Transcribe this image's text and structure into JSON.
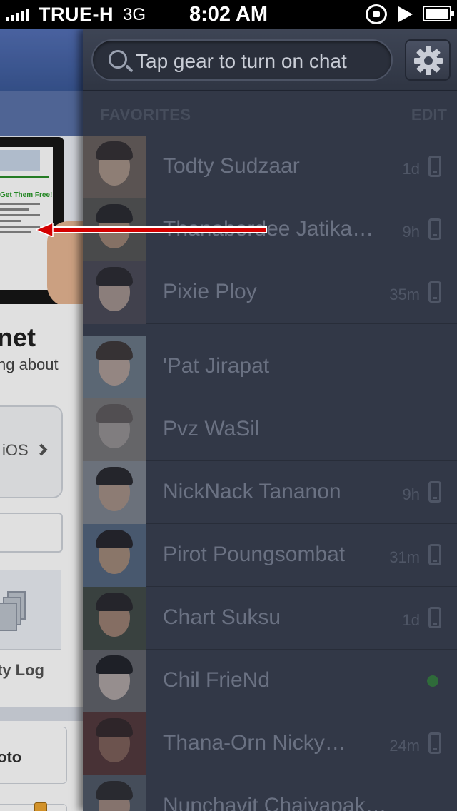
{
  "status_bar": {
    "carrier": "TRUE-H",
    "network": "3G",
    "time": "8:02 AM"
  },
  "left_page": {
    "ad_text": "Get Them Free!",
    "heading": "net",
    "subtext": "ng about",
    "ios_button_label": "iOS",
    "activity_log_label": "ty Log",
    "photo_button_label": "oto"
  },
  "chat": {
    "search": {
      "placeholder": "Tap gear to turn on chat"
    },
    "favorites": {
      "title": "FAVORITES",
      "edit_label": "EDIT"
    },
    "contacts": [
      {
        "name": "Todty Sudzaar",
        "time": "1d",
        "status": "mobile"
      },
      {
        "name": "Thanaberdee Jatika…",
        "time": "9h",
        "status": "mobile"
      },
      {
        "name": "Pixie Ploy",
        "time": "35m",
        "status": "mobile"
      },
      {
        "name": "'Pat Jirapat",
        "time": "",
        "status": "none"
      },
      {
        "name": "Pvz WaSil",
        "time": "",
        "status": "none"
      },
      {
        "name": "NickNack Tananon",
        "time": "9h",
        "status": "mobile"
      },
      {
        "name": "Pirot Poungsombat",
        "time": "31m",
        "status": "mobile"
      },
      {
        "name": "Chart Suksu",
        "time": "1d",
        "status": "mobile"
      },
      {
        "name": "Chil FrieNd",
        "time": "",
        "status": "online"
      },
      {
        "name": "Thana-Orn Nicky…",
        "time": "24m",
        "status": "mobile"
      },
      {
        "name": "Nunchavit Chaiyapaksopon",
        "time": "",
        "status": "none"
      }
    ]
  },
  "colors": {
    "chat_bg": "#323847",
    "facebook_blue": "#3b5998",
    "annotation_arrow": "#d40000",
    "online_green": "#2f6b3a"
  }
}
